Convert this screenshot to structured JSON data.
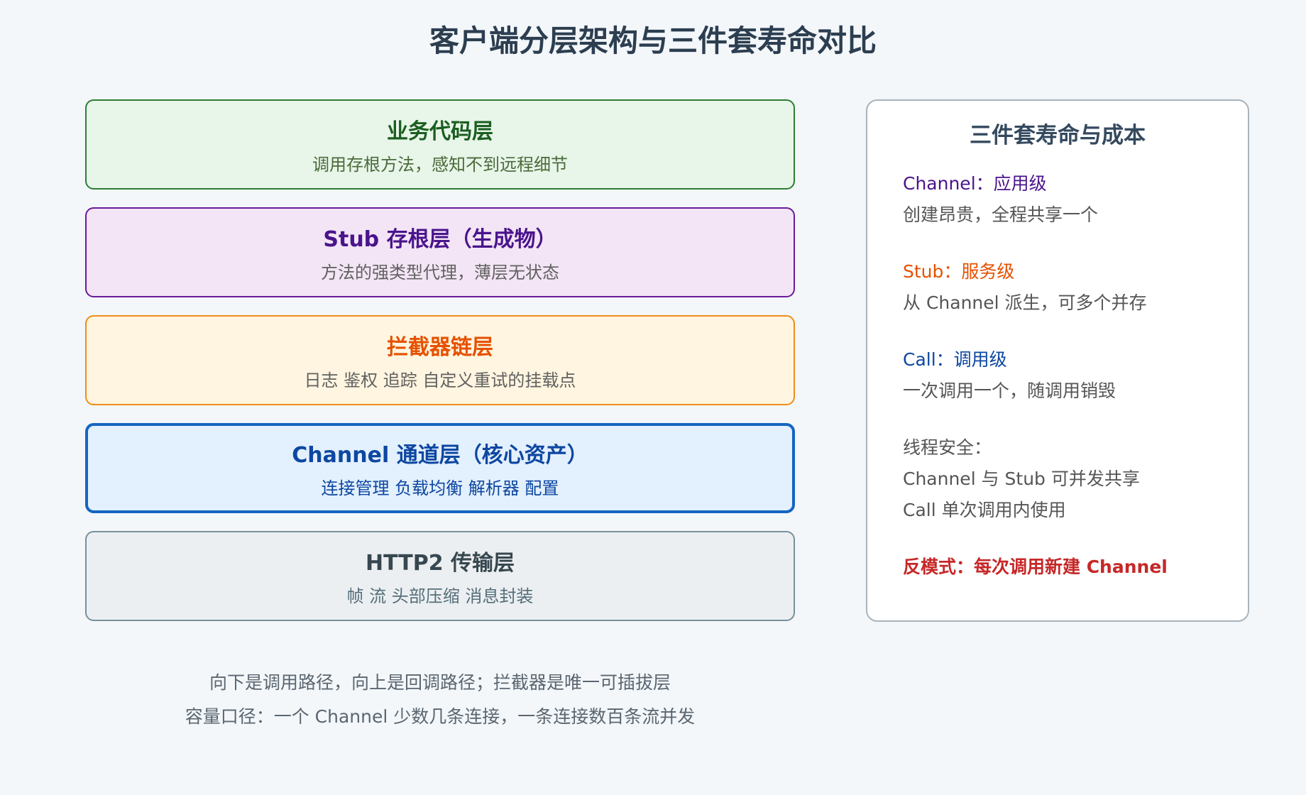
{
  "title": "客户端分层架构与三件套寿命对比",
  "layers": [
    {
      "name": "业务代码层",
      "desc": "调用存根方法，感知不到远程细节",
      "bg": "#e8f5e9",
      "border": "#2e7d32",
      "name_color": "#1b5e20",
      "desc_color": "#4a6b3a"
    },
    {
      "name": "Stub 存根层（生成物）",
      "desc": "方法的强类型代理，薄层无状态",
      "bg": "#f3e5f5",
      "border": "#6a1b9a",
      "name_color": "#4a148c",
      "desc_color": "#616161"
    },
    {
      "name": "拦截器链层",
      "desc": "日志 鉴权 追踪 自定义重试的挂载点",
      "bg": "#fff5e0",
      "border": "#f08c1a",
      "name_color": "#e65100",
      "desc_color": "#616161"
    },
    {
      "name": "Channel 通道层（核心资产）",
      "desc": "连接管理 负载均衡 解析器 配置",
      "bg": "#e3f0fd",
      "border": "#1565c0",
      "name_color": "#0d47a1",
      "desc_color": "#0d47a1"
    },
    {
      "name": "HTTP2 传输层",
      "desc": "帧 流 头部压缩 消息封装",
      "bg": "#eceff1",
      "border": "#78909c",
      "name_color": "#37474f",
      "desc_color": "#546e7a"
    }
  ],
  "panel": {
    "title": "三件套寿命与成本",
    "lines": [
      {
        "text": "Channel：应用级",
        "color": "#4a148c",
        "bold": false
      },
      {
        "text": "创建昂贵，全程共享一个",
        "color": "#555555",
        "bold": false
      },
      {
        "text": "Stub：服务级",
        "color": "#e65100",
        "bold": false
      },
      {
        "text": "从 Channel 派生，可多个并存",
        "color": "#555555",
        "bold": false
      },
      {
        "text": "Call：调用级",
        "color": "#0d47a1",
        "bold": false
      },
      {
        "text": "一次调用一个，随调用销毁",
        "color": "#555555",
        "bold": false
      },
      {
        "text": "线程安全：",
        "color": "#555555",
        "bold": false
      },
      {
        "text": "Channel 与 Stub 可并发共享",
        "color": "#555555",
        "bold": false
      },
      {
        "text": "Call 单次调用内使用",
        "color": "#555555",
        "bold": false
      },
      {
        "text": "反模式：每次调用新建 Channel",
        "color": "#c62828",
        "bold": true
      }
    ]
  },
  "notes": [
    "向下是调用路径，向上是回调路径；拦截器是唯一可插拔层",
    "容量口径：一个 Channel 少数几条连接，一条连接数百条流并发"
  ]
}
